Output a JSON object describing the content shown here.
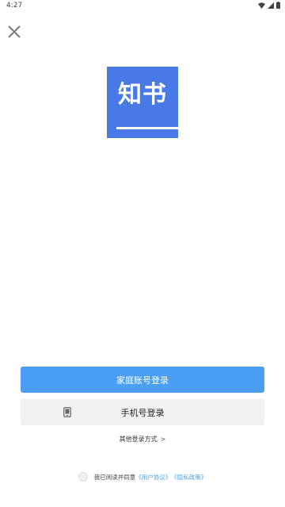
{
  "status_bar": {
    "time": "4:27"
  },
  "logo": {
    "text": "知书",
    "background_color": "#4879e7"
  },
  "buttons": {
    "family_login": "家庭账号登录",
    "phone_login": "手机号登录"
  },
  "other_login": {
    "label": "其他登录方式",
    "chevron": ">"
  },
  "agreement": {
    "prefix": "我已阅读并同意",
    "user_agreement": "《用户协议》",
    "privacy_policy": "《隐私政策》"
  },
  "colors": {
    "accent": "#4a9ff5",
    "secondary_button": "#f1f1f1"
  }
}
